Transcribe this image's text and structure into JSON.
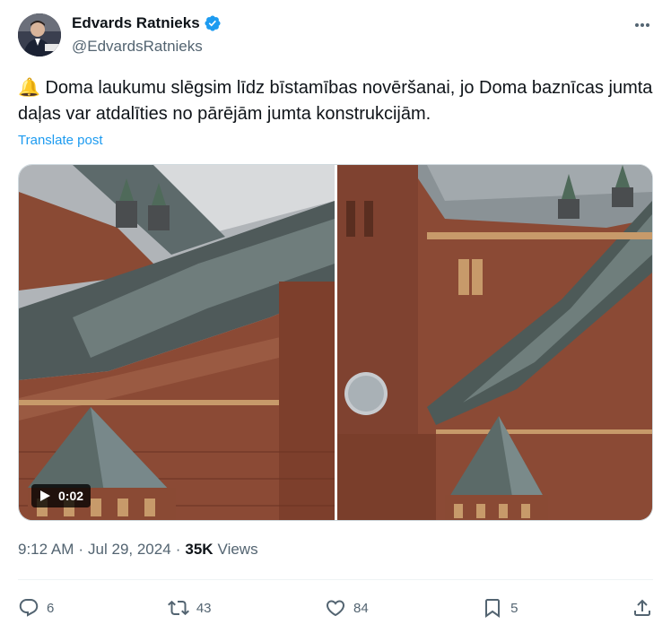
{
  "author": {
    "name": "Edvards Ratnieks",
    "handle": "@EdvardsRatnieks",
    "verified_icon": "verified-badge-icon"
  },
  "post": {
    "emoji": "🔔",
    "text": "Doma laukumu slēgsim līdz bīstamības novēršanai, jo Doma baznīcas jumta daļas var atdalīties no pārējām jumta konstrukcijām.",
    "translate_label": "Translate post"
  },
  "media": {
    "video_duration": "0:02",
    "play_icon": "play-icon"
  },
  "meta": {
    "time": "9:12 AM",
    "date": "Jul 29, 2024",
    "views_count": "35K",
    "views_label": "Views"
  },
  "actions": {
    "replies": "6",
    "reposts": "43",
    "likes": "84",
    "bookmarks": "5"
  },
  "colors": {
    "accent": "#1d9bf0",
    "text": "#0f1419",
    "secondary": "#536471"
  }
}
